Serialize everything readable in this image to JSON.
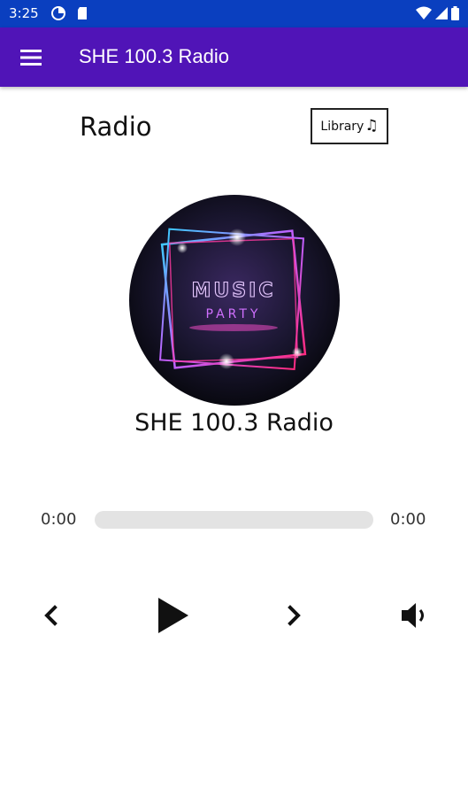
{
  "status_bar": {
    "time": "3:25"
  },
  "app_bar": {
    "title": "SHE 100.3 Radio",
    "menu_icon": "hamburger-menu-icon"
  },
  "header": {
    "title": "Radio",
    "library_label": "Library",
    "library_icon": "music-note-icon"
  },
  "player": {
    "artwork_text_line1": "MUSIC",
    "artwork_text_line2": "PARTY",
    "station_name": "SHE 100.3 Radio",
    "elapsed": "0:00",
    "duration": "0:00",
    "progress": 0
  },
  "controls": {
    "previous_icon": "chevron-left-icon",
    "play_icon": "play-icon",
    "next_icon": "chevron-right-icon",
    "volume_icon": "volume-icon"
  },
  "colors": {
    "status_bar": "#0a3fbf",
    "app_bar": "#5014b7",
    "track": "#e3e3e3"
  }
}
